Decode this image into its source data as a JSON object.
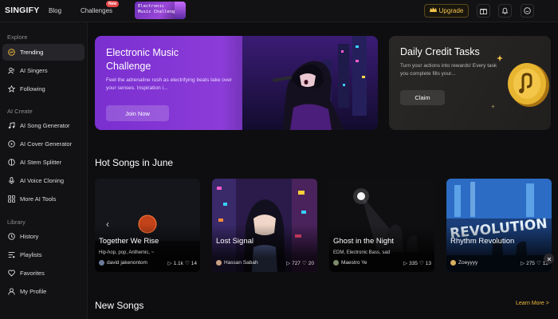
{
  "app": {
    "logo": "SINGIFY"
  },
  "topnav": {
    "blog": "Blog",
    "challenges": "Challenges",
    "new_badge": "New",
    "promo": "Electronic Music Challenge",
    "upgrade": "Upgrade",
    "icons": [
      "gift-icon",
      "bell-icon",
      "chat-icon",
      "crown-icon"
    ]
  },
  "sidebar": {
    "explore_title": "Explore",
    "explore": [
      {
        "label": "Trending",
        "icon": "trending-icon",
        "active": true
      },
      {
        "label": "AI Singers",
        "icon": "singer-icon"
      },
      {
        "label": "Following",
        "icon": "star-icon"
      }
    ],
    "create_title": "AI Create",
    "create": [
      {
        "label": "AI Song Generator",
        "icon": "music-note-icon"
      },
      {
        "label": "AI Cover Generator",
        "icon": "disc-icon"
      },
      {
        "label": "AI Stem Splitter",
        "icon": "stem-icon"
      },
      {
        "label": "AI Voice Cloning",
        "icon": "microphone-icon"
      },
      {
        "label": "More AI Tools",
        "icon": "grid-icon"
      }
    ],
    "library_title": "Library",
    "library": [
      {
        "label": "History",
        "icon": "history-icon"
      },
      {
        "label": "Playlists",
        "icon": "playlist-icon"
      },
      {
        "label": "Favorites",
        "icon": "heart-icon"
      },
      {
        "label": "My Profile",
        "icon": "user-icon"
      }
    ]
  },
  "banner_main": {
    "title": "Electronic Music Challenge",
    "desc": "Feel the adrenaline rush as electrifying beats take over your senses. Inspiration i...",
    "button": "Join Now"
  },
  "banner_credit": {
    "title": "Daily Credit Tasks",
    "desc": "Turn your actions into rewards! Every task you complete fills your...",
    "button": "Claim"
  },
  "hot_songs": {
    "title": "Hot Songs in June",
    "songs": [
      {
        "title": "Together We Rise",
        "tags": "Hip-hop, pop, Anthemic, ~",
        "author": "david jakenontom",
        "plays": "1.1k",
        "likes": "14"
      },
      {
        "title": "Lost Signal",
        "tags": "",
        "author": "Hassan Sabah",
        "plays": "727",
        "likes": "20"
      },
      {
        "title": "Ghost in the Night",
        "tags": "EDM, Electronic Bass, sad",
        "author": "Maestro Ye",
        "plays": "335",
        "likes": "13"
      },
      {
        "title": "Rhythm Revolution",
        "tags": "",
        "author": "Zoeyyyy",
        "plays": "275",
        "likes": "12"
      }
    ]
  },
  "new_songs": {
    "title": "New Songs",
    "learn_more": "Learn More >"
  },
  "colors": {
    "accent_gold": "#f0b93c",
    "banner_purple": "#8c3cd8",
    "badge_red": "#e5484d"
  }
}
